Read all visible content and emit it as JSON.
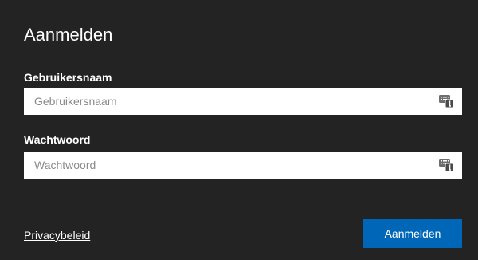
{
  "dialog": {
    "title": "Aanmelden"
  },
  "username": {
    "label": "Gebruikersnaam",
    "placeholder": "Gebruikersnaam",
    "value": "",
    "icon": "password-manager-keys-icon"
  },
  "password": {
    "label": "Wachtwoord",
    "placeholder": "Wachtwoord",
    "value": "",
    "icon": "password-manager-keys-icon"
  },
  "footer": {
    "privacy_link": "Privacybeleid",
    "submit_label": "Aanmelden"
  },
  "colors": {
    "background": "#232323",
    "accent": "#0067b8",
    "field_background": "#ffffff",
    "placeholder_text": "#8a8a8a"
  }
}
